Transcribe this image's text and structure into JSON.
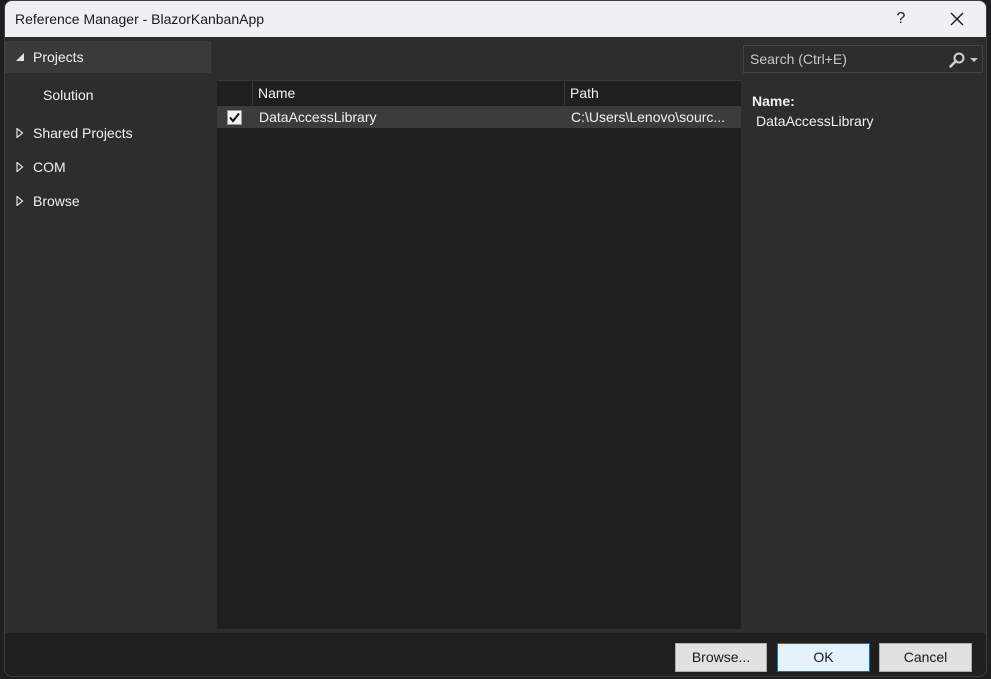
{
  "window": {
    "title": "Reference Manager - BlazorKanbanApp",
    "help_label": "?",
    "close_icon": "close-icon"
  },
  "sidebar": {
    "items": [
      {
        "label": "Projects",
        "expanded": true,
        "selected": true,
        "icon": "triangle-down-icon"
      },
      {
        "label": "Solution",
        "child": true
      },
      {
        "label": "Shared Projects",
        "expanded": false,
        "icon": "triangle-right-icon"
      },
      {
        "label": "COM",
        "expanded": false,
        "icon": "triangle-right-icon"
      },
      {
        "label": "Browse",
        "expanded": false,
        "icon": "triangle-right-icon"
      }
    ]
  },
  "search": {
    "placeholder": "Search (Ctrl+E)",
    "value": "",
    "icon": "search-icon"
  },
  "grid": {
    "columns": [
      "",
      "Name",
      "Path"
    ],
    "rows": [
      {
        "checked": true,
        "name": "DataAccessLibrary",
        "path": "C:\\Users\\Lenovo\\sourc..."
      }
    ]
  },
  "details": {
    "name_label": "Name:",
    "name_value": "DataAccessLibrary"
  },
  "footer": {
    "browse_label": "Browse...",
    "ok_label": "OK",
    "cancel_label": "Cancel"
  }
}
